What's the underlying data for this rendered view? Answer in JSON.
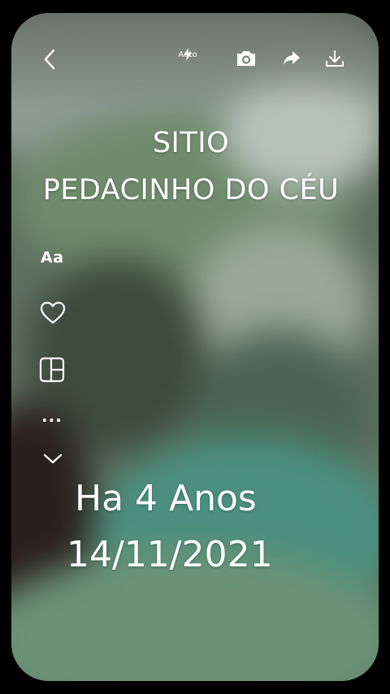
{
  "toolbar": {
    "back_icon": "chevron-left-icon",
    "flash_icon": "flash-icon",
    "flash_label": "Auto",
    "camera_icon": "camera-icon",
    "share_icon": "share-arrow-icon",
    "download_icon": "download-icon"
  },
  "title": {
    "line1": "SITIO",
    "line2": "PEDACINHO DO CÉU"
  },
  "side_tools": {
    "text_label": "Aa",
    "heart_icon": "heart-icon",
    "layout_icon": "layout-grid-icon",
    "more_label": "...",
    "collapse_icon": "chevron-down-icon"
  },
  "memory": {
    "years_text": "Ha 4 Anos",
    "date_text": "14/11/2021"
  },
  "colors": {
    "text": "#ffffff",
    "frame": "#000000",
    "background_tint": "#5f6f60"
  }
}
